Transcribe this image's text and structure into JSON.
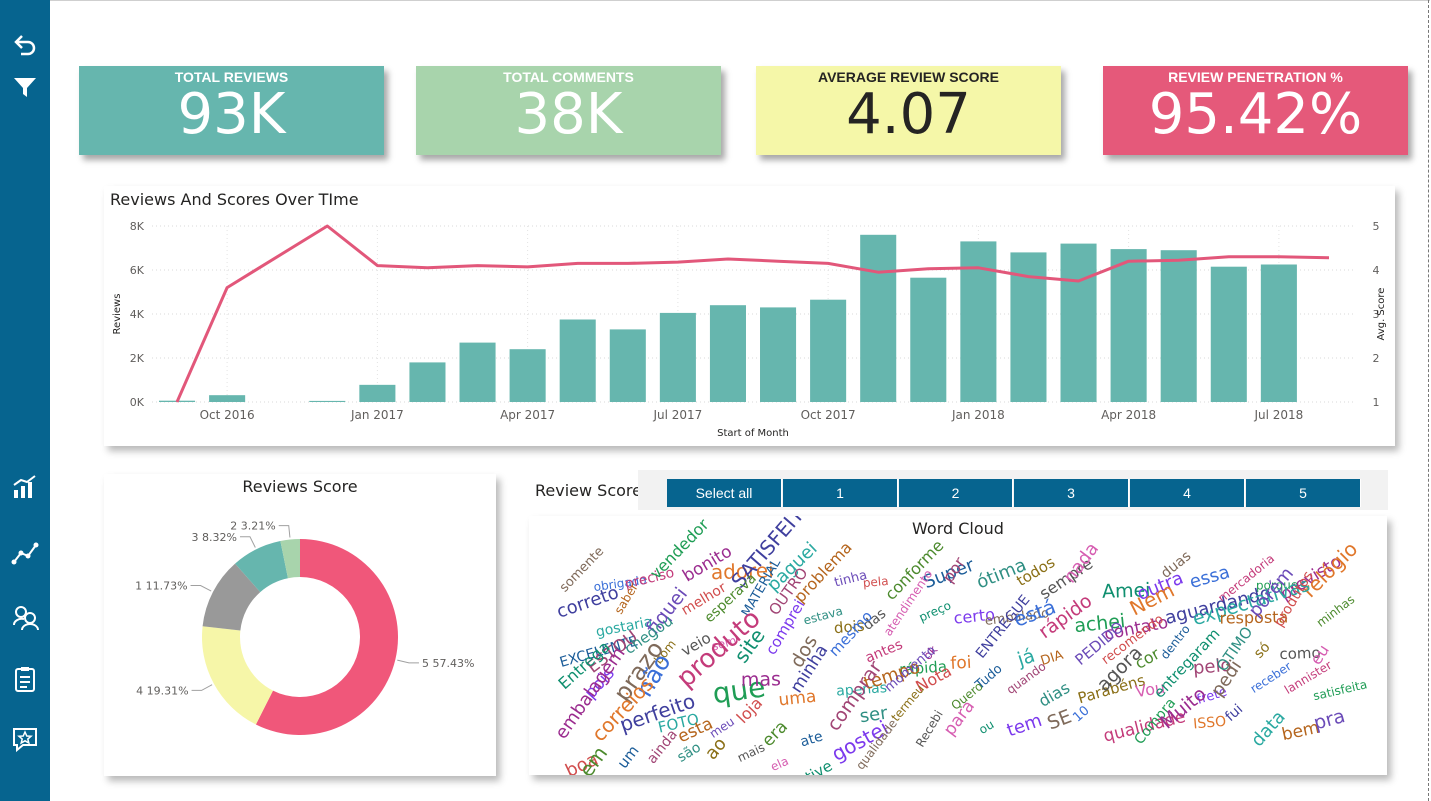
{
  "kpis": [
    {
      "title": "TOTAL REVIEWS",
      "value": "93K",
      "color": "#66b6ae"
    },
    {
      "title": "TOTAL COMMENTS",
      "value": "38K",
      "color": "#a8d4ac"
    },
    {
      "title": "AVERAGE REVIEW SCORE",
      "value": "4.07",
      "color": "#f5f7a8"
    },
    {
      "title": "REVIEW PENETRATION %",
      "value": "95.42%",
      "color": "#e5597a"
    }
  ],
  "sidebar": {
    "icons": [
      "back-icon",
      "filter-icon",
      "bar-chart-icon",
      "line-chart-icon",
      "users-icon",
      "clipboard-icon",
      "star-message-icon"
    ]
  },
  "slicer": {
    "label": "Review Score:",
    "options": [
      "Select all",
      "1",
      "2",
      "3",
      "4",
      "5"
    ]
  },
  "word_cloud": {
    "title": "Word Cloud",
    "words": [
      "somente",
      "obrigado",
      "preciso",
      "vendedor",
      "bonito",
      "adorei",
      "SATISFEITO",
      "paguei",
      "problema",
      "tinha",
      "pela",
      "conforme",
      "Super",
      "por",
      "ótima",
      "todos",
      "sempre",
      "nada",
      "Amei",
      "outra",
      "duas",
      "essa",
      "mercadoria",
      "porque",
      "previsto",
      "relógio",
      "correto",
      "gostaria",
      "saber",
      "fiquei",
      "melhor",
      "esperava",
      "MATERIAL",
      "OUTRO",
      "estava",
      "dois",
      "das",
      "atendimento",
      "preço",
      "certo",
      "embalado",
      "está",
      "rápido",
      "achei",
      "contato",
      "Nem",
      "aguardando",
      "expectativas",
      "resposta",
      "porém",
      "produtos",
      "minhas",
      "EXCELENTE",
      "ESTOU",
      "chegou",
      "bom",
      "veio",
      "sem",
      "site",
      "comprei",
      "dos",
      "mesmo",
      "antes",
      "rápida",
      "ok",
      "foi",
      "ENTREGUE",
      "já",
      "DIA",
      "PEDIDO",
      "recomendo",
      "cor",
      "dentro",
      "pelo",
      "ÓTIMO",
      "só",
      "como",
      "eu",
      "Entrega",
      "pois",
      "prazo",
      "não",
      "produto",
      "que",
      "mas",
      "uma",
      "minha",
      "apenas",
      "tempo",
      "momento",
      "Nota",
      "Quero",
      "Tudo",
      "quando",
      "dias",
      "Parabéns",
      "agora",
      "Vou",
      "entregaram",
      "frete",
      "pedi",
      "receber",
      "lannister",
      "satisfeita",
      "embalagem",
      "correios",
      "perfeito",
      "FOTO",
      "esta",
      "meu",
      "loja",
      "era",
      "ate",
      "comprar",
      "ser",
      "termeu",
      "Recebi",
      "para",
      "ou",
      "tem",
      "SE",
      "10",
      "qualidade",
      "Compra",
      "Muito",
      "ISSO",
      "fui",
      "data",
      "bem",
      "pra",
      "boa",
      "em",
      "um",
      "ainda",
      "são",
      "ao",
      "mais",
      "ela",
      "tive",
      "gostei",
      "qualidade"
    ]
  },
  "chart_data": [
    {
      "type": "bar+line",
      "title": "Reviews And Scores Over TIme",
      "xlabel": "Start of Month",
      "ylabel": "Reviews",
      "y2label": "Avg. Score",
      "ylim": [
        0,
        8000
      ],
      "y2lim": [
        1,
        5
      ],
      "yticks": [
        "0K",
        "2K",
        "4K",
        "6K",
        "8K"
      ],
      "y2ticks": [
        "1",
        "2",
        "3",
        "4",
        "5"
      ],
      "xticks": [
        "Oct 2016",
        "Jan 2017",
        "Apr 2017",
        "Jul 2017",
        "Oct 2017",
        "Jan 2018",
        "Apr 2018",
        "Jul 2018"
      ],
      "grid": true,
      "bar_color": "#66b6ae",
      "line_color": "#e2577a",
      "months": [
        "2016-09",
        "2016-10",
        "2016-11",
        "2016-12",
        "2017-01",
        "2017-02",
        "2017-03",
        "2017-04",
        "2017-05",
        "2017-06",
        "2017-07",
        "2017-08",
        "2017-09",
        "2017-10",
        "2017-11",
        "2017-12",
        "2018-01",
        "2018-02",
        "2018-03",
        "2018-04",
        "2018-05",
        "2018-06",
        "2018-07",
        "2018-08"
      ],
      "series": [
        {
          "name": "Reviews",
          "kind": "bar",
          "values": [
            60,
            310,
            0,
            50,
            780,
            1800,
            2700,
            2400,
            3750,
            3300,
            4050,
            4400,
            4300,
            4650,
            7600,
            5650,
            7300,
            6800,
            7200,
            6950,
            6900,
            6150,
            6250,
            null
          ]
        },
        {
          "name": "Avg. Score",
          "kind": "line",
          "values": [
            1.0,
            3.6,
            null,
            5.0,
            4.1,
            4.05,
            4.1,
            4.07,
            4.15,
            4.15,
            4.18,
            4.25,
            4.2,
            4.15,
            3.95,
            4.03,
            4.05,
            3.85,
            3.75,
            4.2,
            4.22,
            4.3,
            4.3,
            4.28
          ]
        }
      ]
    },
    {
      "type": "pie",
      "title": "Reviews Score",
      "donut": true,
      "slices": [
        {
          "label": "5",
          "value": 57.43,
          "pct": "57.43%",
          "color": "#f0577a"
        },
        {
          "label": "4",
          "value": 19.31,
          "pct": "19.31%",
          "color": "#f6f6a8"
        },
        {
          "label": "1",
          "value": 11.73,
          "pct": "11.73%",
          "color": "#999999"
        },
        {
          "label": "3",
          "value": 8.32,
          "pct": "8.32%",
          "color": "#66b6ae"
        },
        {
          "label": "2",
          "value": 3.21,
          "pct": "3.21%",
          "color": "#a8d4ac"
        }
      ]
    }
  ]
}
